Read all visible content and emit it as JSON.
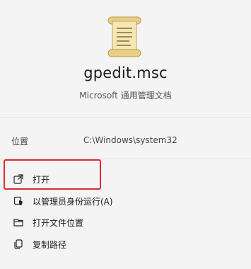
{
  "file": {
    "name": "gpedit.msc",
    "type": "Microsoft 通用管理文档",
    "icon": "scroll-document-icon"
  },
  "location": {
    "label": "位置",
    "value": "C:\\Windows\\system32"
  },
  "actions": [
    {
      "label": "打开",
      "icon": "open-external-icon"
    },
    {
      "label": "以管理员身份运行(A)",
      "icon": "shield-admin-icon"
    },
    {
      "label": "打开文件位置",
      "icon": "folder-icon"
    },
    {
      "label": "复制路径",
      "icon": "copy-icon"
    }
  ],
  "colors": {
    "highlight": "#e02a2a",
    "background": "#f4f4f4"
  }
}
